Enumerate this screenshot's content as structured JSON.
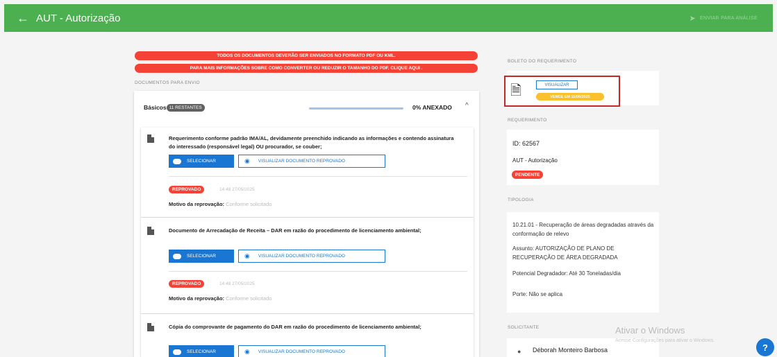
{
  "appbar": {
    "back_icon": "←",
    "title": "AUT - Autorização",
    "send_icon": "➤",
    "send_label": "ENVIAR PARA ANÁLISE"
  },
  "banners": {
    "line1": "TODOS OS DOCUMENTOS DEVERÃO SER ENVIADOS NO FORMATO PDF OU KML.",
    "line2": "PARA MAIS INFORMAÇÕES SOBRE COMO CONVERTER OU REDUZIR O TAMANHO DO PDF, CLIQUE AQUI ."
  },
  "docs": {
    "section_label": "DOCUMENTOS PARA ENVIO",
    "group_label": "Básicos",
    "remaining_badge": "11 RESTANTES",
    "progress_fraction": 0,
    "progress_text": "0% ANEXADO",
    "chevron": "^",
    "select_label": "SELECIONAR",
    "view_label": "VISUALIZAR DOCUMENTO REPROVADO",
    "motivo_label": "Motivo da reprovação:",
    "items": [
      {
        "title": "Requerimento conforme padrão IMA/AL, devidamente preenchido indicando as informações e contendo assinatura do interessado (responsável legal) OU procurador, se couber;",
        "status": "REPROVADO",
        "date": "14:48 27/05/2025",
        "motivo": "Conforme solicitado"
      },
      {
        "title": "Documento de Arrecadação de Receita – DAR em razão do procedimento de licenciamento ambiental;",
        "status": "REPROVADO",
        "date": "14:48 27/05/2025",
        "motivo": "Conforme solicitado"
      },
      {
        "title": "Cópia do comprovante de pagamento do DAR em razão do procedimento de licenciamento ambiental;"
      }
    ]
  },
  "boleto": {
    "section_label": "BOLETO DO REQUERIMENTO",
    "view_label": "VISUALIZAR",
    "due_badge": "VENCE EM 11/06/2025"
  },
  "requerimento": {
    "section_label": "REQUERIMENTO",
    "id_text": "ID: 62567",
    "type_text": "AUT - Autorização",
    "status_badge": "PENDENTE"
  },
  "tipologia": {
    "section_label": "TIPOLOGIA",
    "code_text": "10.21.01 - Recuperação de áreas degradadas através da conformação de relevo",
    "assunto_text": "Assunto: AUTORIZAÇÃO DE PLANO DE RECUPERAÇÃO DE ÁREA DEGRADADA",
    "potencial_text": "Potencial Degradador: Até 30 Toneladas/dia",
    "porte_text": "Porte: Não se aplica"
  },
  "solicitante": {
    "section_label": "SOLICITANTE",
    "name": "Déborah Monteiro Barbosa"
  },
  "watermark": {
    "title": "Ativar o Windows",
    "subtitle": "Acesse Configurações para ativar o Windows."
  },
  "help": {
    "label": "?"
  },
  "colors": {
    "appbar": "#4caf50",
    "primary": "#1976d2",
    "danger": "#f44336",
    "warning": "#fbc02d"
  }
}
